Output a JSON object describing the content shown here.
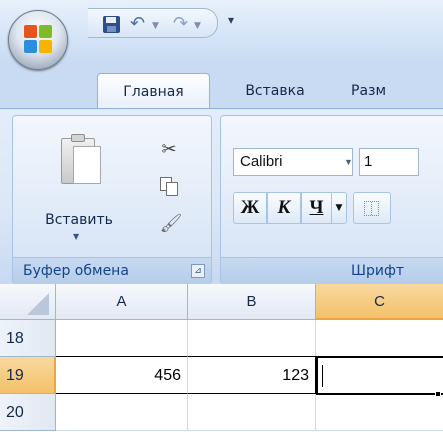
{
  "quick_access": {
    "office_button": "office-logo",
    "items": [
      "save-icon",
      "undo-icon",
      "redo-icon"
    ],
    "customize": "▾"
  },
  "ribbon": {
    "tabs": [
      {
        "label": "Главная",
        "active": true
      },
      {
        "label": "Вставка",
        "active": false
      },
      {
        "label": "Разм",
        "active": false
      }
    ],
    "clipboard": {
      "paste_label": "Вставить",
      "group_label": "Буфер обмена",
      "launcher": "⊿"
    },
    "font": {
      "font_name": "Calibri",
      "font_size": "1",
      "bold": "Ж",
      "italic": "К",
      "underline": "Ч",
      "group_label": "Шрифт"
    }
  },
  "sheet": {
    "columns": [
      "A",
      "B",
      "C"
    ],
    "active_column": "C",
    "rows": [
      {
        "header": "18",
        "A": "",
        "B": "",
        "C": ""
      },
      {
        "header": "19",
        "A": "456",
        "B": "123",
        "C": ""
      },
      {
        "header": "20",
        "A": "",
        "B": "",
        "C": ""
      }
    ]
  },
  "colors": {
    "ribbon_bg": "#dbe7f7",
    "active_header": "#f3c16a",
    "group_label_text": "#15428b"
  }
}
